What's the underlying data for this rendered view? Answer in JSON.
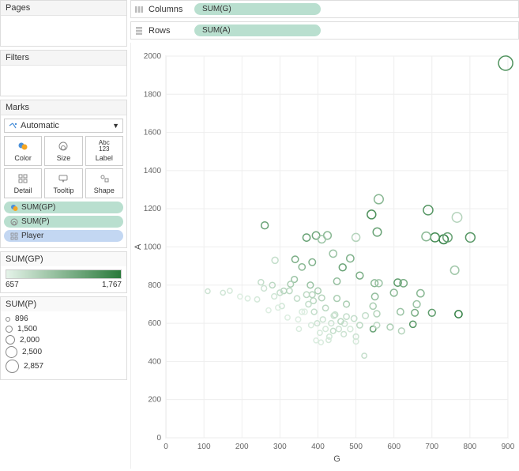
{
  "shelves": {
    "columns_label": "Columns",
    "rows_label": "Rows",
    "columns_pill": "SUM(G)",
    "rows_pill": "SUM(A)"
  },
  "panels": {
    "pages": "Pages",
    "filters": "Filters",
    "marks": "Marks"
  },
  "marks": {
    "dropdown": "Automatic",
    "color": "Color",
    "size": "Size",
    "label": "Label",
    "detail": "Detail",
    "tooltip": "Tooltip",
    "shape": "Shape",
    "pills": {
      "gp": "SUM(GP)",
      "p": "SUM(P)",
      "player": "Player"
    }
  },
  "legends": {
    "color_title": "SUM(GP)",
    "color_min": "657",
    "color_max": "1,767",
    "size_title": "SUM(P)",
    "size_items": [
      {
        "label": "896",
        "d": 6
      },
      {
        "label": "1,500",
        "d": 9
      },
      {
        "label": "2,000",
        "d": 12
      },
      {
        "label": "2,500",
        "d": 15
      },
      {
        "label": "2,857",
        "d": 17
      }
    ]
  },
  "chart_data": {
    "type": "scatter",
    "xlabel": "G",
    "ylabel": "A",
    "xlim": [
      0,
      900
    ],
    "ylim": [
      0,
      2000
    ],
    "xticks": [
      0,
      100,
      200,
      300,
      400,
      500,
      600,
      700,
      800,
      900
    ],
    "yticks": [
      0,
      200,
      400,
      600,
      800,
      1000,
      1200,
      1400,
      1600,
      1800,
      2000
    ],
    "color_field": "GP",
    "color_range": [
      657,
      1767
    ],
    "size_field": "P",
    "size_range": [
      896,
      2857
    ],
    "points": [
      {
        "G": 894,
        "A": 1963,
        "GP": 1550,
        "P": 2857
      },
      {
        "G": 731,
        "A": 1040,
        "GP": 1700,
        "P": 1771
      },
      {
        "G": 690,
        "A": 1193,
        "GP": 1500,
        "P": 1883
      },
      {
        "G": 708,
        "A": 1050,
        "GP": 1600,
        "P": 1758
      },
      {
        "G": 741,
        "A": 1050,
        "GP": 1400,
        "P": 1791
      },
      {
        "G": 766,
        "A": 1155,
        "GP": 950,
        "P": 1921
      },
      {
        "G": 801,
        "A": 1050,
        "GP": 1500,
        "P": 1851
      },
      {
        "G": 685,
        "A": 1055,
        "GP": 1200,
        "P": 1740
      },
      {
        "G": 560,
        "A": 1250,
        "GP": 1200,
        "P": 1810
      },
      {
        "G": 556,
        "A": 1078,
        "GP": 1400,
        "P": 1634
      },
      {
        "G": 541,
        "A": 1170,
        "GP": 1550,
        "P": 1711
      },
      {
        "G": 549,
        "A": 810,
        "GP": 1200,
        "P": 1359
      },
      {
        "G": 610,
        "A": 813,
        "GP": 1450,
        "P": 1423
      },
      {
        "G": 625,
        "A": 810,
        "GP": 1300,
        "P": 1435
      },
      {
        "G": 560,
        "A": 810,
        "GP": 1100,
        "P": 1370
      },
      {
        "G": 500,
        "A": 1050,
        "GP": 950,
        "P": 1550
      },
      {
        "G": 485,
        "A": 940,
        "GP": 1250,
        "P": 1425
      },
      {
        "G": 425,
        "A": 1060,
        "GP": 1200,
        "P": 1485
      },
      {
        "G": 395,
        "A": 1060,
        "GP": 1350,
        "P": 1455
      },
      {
        "G": 410,
        "A": 1040,
        "GP": 1100,
        "P": 1450
      },
      {
        "G": 465,
        "A": 893,
        "GP": 1400,
        "P": 1358
      },
      {
        "G": 440,
        "A": 965,
        "GP": 1100,
        "P": 1405
      },
      {
        "G": 370,
        "A": 1049,
        "GP": 1400,
        "P": 1419
      },
      {
        "G": 358,
        "A": 895,
        "GP": 1200,
        "P": 1253
      },
      {
        "G": 340,
        "A": 935,
        "GP": 1300,
        "P": 1275
      },
      {
        "G": 260,
        "A": 1113,
        "GP": 1400,
        "P": 1373
      },
      {
        "G": 287,
        "A": 930,
        "GP": 850,
        "P": 1217
      },
      {
        "G": 385,
        "A": 920,
        "GP": 1250,
        "P": 1305
      },
      {
        "G": 770,
        "A": 648,
        "GP": 1700,
        "P": 1418
      },
      {
        "G": 760,
        "A": 878,
        "GP": 1050,
        "P": 1638
      },
      {
        "G": 655,
        "A": 655,
        "GP": 1300,
        "P": 1310
      },
      {
        "G": 700,
        "A": 655,
        "GP": 1450,
        "P": 1355
      },
      {
        "G": 660,
        "A": 700,
        "GP": 1100,
        "P": 1360
      },
      {
        "G": 670,
        "A": 757,
        "GP": 1200,
        "P": 1427
      },
      {
        "G": 600,
        "A": 760,
        "GP": 1200,
        "P": 1360
      },
      {
        "G": 650,
        "A": 595,
        "GP": 1500,
        "P": 1245
      },
      {
        "G": 617,
        "A": 660,
        "GP": 1100,
        "P": 1277
      },
      {
        "G": 590,
        "A": 580,
        "GP": 1000,
        "P": 1170
      },
      {
        "G": 620,
        "A": 560,
        "GP": 950,
        "P": 1180
      },
      {
        "G": 545,
        "A": 690,
        "GP": 1000,
        "P": 1235
      },
      {
        "G": 555,
        "A": 650,
        "GP": 950,
        "P": 1205
      },
      {
        "G": 545,
        "A": 570,
        "GP": 1400,
        "P": 1115
      },
      {
        "G": 555,
        "A": 590,
        "GP": 900,
        "P": 1145
      },
      {
        "G": 550,
        "A": 740,
        "GP": 1150,
        "P": 1290
      },
      {
        "G": 525,
        "A": 640,
        "GP": 850,
        "P": 1165
      },
      {
        "G": 522,
        "A": 430,
        "GP": 850,
        "P": 952
      },
      {
        "G": 510,
        "A": 850,
        "GP": 1300,
        "P": 1360
      },
      {
        "G": 510,
        "A": 590,
        "GP": 900,
        "P": 1100
      },
      {
        "G": 495,
        "A": 625,
        "GP": 850,
        "P": 1120
      },
      {
        "G": 500,
        "A": 530,
        "GP": 800,
        "P": 1030
      },
      {
        "G": 500,
        "A": 505,
        "GP": 750,
        "P": 1005
      },
      {
        "G": 485,
        "A": 570,
        "GP": 750,
        "P": 1055
      },
      {
        "G": 475,
        "A": 700,
        "GP": 1000,
        "P": 1175
      },
      {
        "G": 475,
        "A": 635,
        "GP": 850,
        "P": 1110
      },
      {
        "G": 470,
        "A": 598,
        "GP": 800,
        "P": 1068
      },
      {
        "G": 468,
        "A": 543,
        "GP": 800,
        "P": 1011
      },
      {
        "G": 460,
        "A": 610,
        "GP": 900,
        "P": 1070
      },
      {
        "G": 455,
        "A": 570,
        "GP": 800,
        "P": 1025
      },
      {
        "G": 450,
        "A": 820,
        "GP": 1150,
        "P": 1270
      },
      {
        "G": 450,
        "A": 730,
        "GP": 1000,
        "P": 1180
      },
      {
        "G": 445,
        "A": 645,
        "GP": 850,
        "P": 1090
      },
      {
        "G": 442,
        "A": 640,
        "GP": 820,
        "P": 1082
      },
      {
        "G": 440,
        "A": 560,
        "GP": 850,
        "P": 1000
      },
      {
        "G": 435,
        "A": 600,
        "GP": 800,
        "P": 1035
      },
      {
        "G": 430,
        "A": 530,
        "GP": 780,
        "P": 960
      },
      {
        "G": 428,
        "A": 512,
        "GP": 750,
        "P": 940
      },
      {
        "G": 420,
        "A": 680,
        "GP": 900,
        "P": 1100
      },
      {
        "G": 420,
        "A": 570,
        "GP": 750,
        "P": 990
      },
      {
        "G": 413,
        "A": 620,
        "GP": 800,
        "P": 1033
      },
      {
        "G": 410,
        "A": 733,
        "GP": 950,
        "P": 1143
      },
      {
        "G": 408,
        "A": 500,
        "GP": 720,
        "P": 908
      },
      {
        "G": 405,
        "A": 550,
        "GP": 750,
        "P": 955
      },
      {
        "G": 400,
        "A": 770,
        "GP": 1000,
        "P": 1170
      },
      {
        "G": 398,
        "A": 600,
        "GP": 800,
        "P": 998
      },
      {
        "G": 395,
        "A": 510,
        "GP": 720,
        "P": 905
      },
      {
        "G": 390,
        "A": 660,
        "GP": 850,
        "P": 1050
      },
      {
        "G": 388,
        "A": 718,
        "GP": 900,
        "P": 1106
      },
      {
        "G": 385,
        "A": 750,
        "GP": 950,
        "P": 1135
      },
      {
        "G": 382,
        "A": 590,
        "GP": 730,
        "P": 972
      },
      {
        "G": 380,
        "A": 800,
        "GP": 1100,
        "P": 1180
      },
      {
        "G": 375,
        "A": 700,
        "GP": 850,
        "P": 1075
      },
      {
        "G": 370,
        "A": 750,
        "GP": 900,
        "P": 1120
      },
      {
        "G": 365,
        "A": 660,
        "GP": 700,
        "P": 1025
      },
      {
        "G": 358,
        "A": 660,
        "GP": 720,
        "P": 1018
      },
      {
        "G": 350,
        "A": 570,
        "GP": 720,
        "P": 920
      },
      {
        "G": 348,
        "A": 620,
        "GP": 700,
        "P": 968
      },
      {
        "G": 345,
        "A": 730,
        "GP": 850,
        "P": 1075
      },
      {
        "G": 338,
        "A": 830,
        "GP": 1100,
        "P": 1168
      },
      {
        "G": 328,
        "A": 805,
        "GP": 1000,
        "P": 1133
      },
      {
        "G": 325,
        "A": 770,
        "GP": 900,
        "P": 1095
      },
      {
        "G": 320,
        "A": 630,
        "GP": 700,
        "P": 950
      },
      {
        "G": 310,
        "A": 770,
        "GP": 950,
        "P": 1080
      },
      {
        "G": 305,
        "A": 690,
        "GP": 780,
        "P": 995
      },
      {
        "G": 300,
        "A": 760,
        "GP": 850,
        "P": 1060
      },
      {
        "G": 295,
        "A": 682,
        "GP": 700,
        "P": 977
      },
      {
        "G": 285,
        "A": 741,
        "GP": 780,
        "P": 1026
      },
      {
        "G": 280,
        "A": 800,
        "GP": 900,
        "P": 1080
      },
      {
        "G": 270,
        "A": 668,
        "GP": 700,
        "P": 938
      },
      {
        "G": 258,
        "A": 783,
        "GP": 800,
        "P": 1041
      },
      {
        "G": 250,
        "A": 815,
        "GP": 850,
        "P": 1065
      },
      {
        "G": 240,
        "A": 725,
        "GP": 750,
        "P": 965
      },
      {
        "G": 215,
        "A": 730,
        "GP": 720,
        "P": 945
      },
      {
        "G": 195,
        "A": 740,
        "GP": 700,
        "P": 935
      },
      {
        "G": 168,
        "A": 770,
        "GP": 750,
        "P": 938
      },
      {
        "G": 150,
        "A": 760,
        "GP": 780,
        "P": 910
      },
      {
        "G": 110,
        "A": 768,
        "GP": 800,
        "P": 878
      }
    ]
  }
}
